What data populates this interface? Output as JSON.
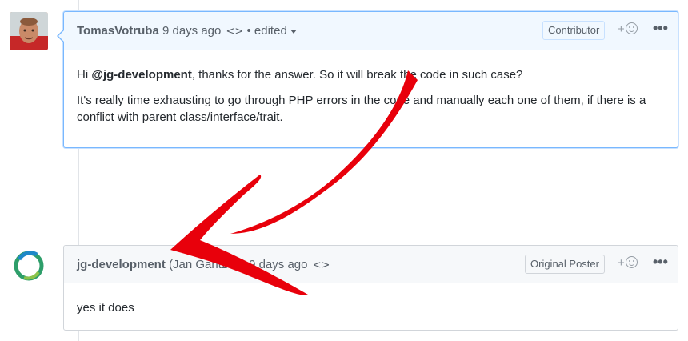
{
  "comments": [
    {
      "author": "TomasVotruba",
      "time": "9 days ago",
      "code_glyph": "<>",
      "edited_label": "• edited",
      "badge": "Contributor",
      "react_plus": "+",
      "more_glyph": "•••",
      "body": {
        "p1_prefix": "Hi ",
        "p1_mention": "@jg-development",
        "p1_suffix": ", thanks for the answer. So it will break the code in such case?",
        "p2": "It's really time exhausting to go through PHP errors in the code and manually each one of them, if there is a conflict with parent class/interface/trait."
      }
    },
    {
      "author": "jg-development",
      "fullname": "(Jan Gantzert)",
      "time": "9 days ago",
      "code_glyph": "<>",
      "badge": "Original Poster",
      "react_plus": "+",
      "more_glyph": "•••",
      "body": {
        "text": "yes it does"
      }
    }
  ],
  "colors": {
    "highlight_border": "#79b8ff",
    "header_bg_highlight": "#f1f8ff",
    "header_bg": "#f6f8fa",
    "annotation_arrow": "#e8000b"
  }
}
